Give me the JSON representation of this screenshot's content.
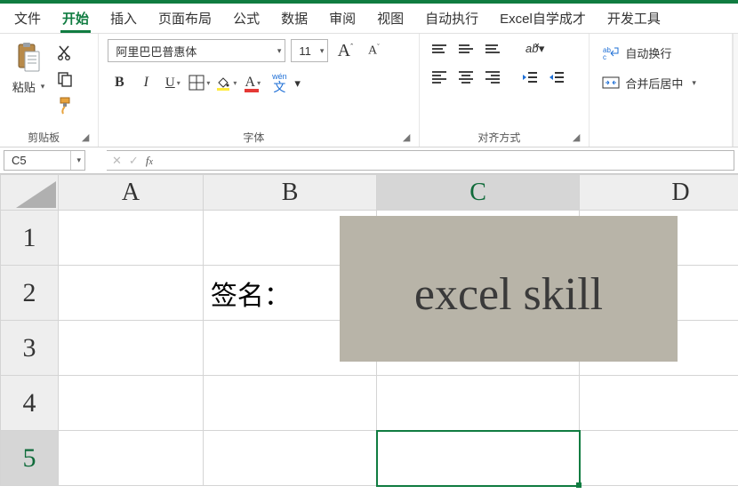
{
  "tabs": {
    "items": [
      {
        "label": "文件"
      },
      {
        "label": "开始"
      },
      {
        "label": "插入"
      },
      {
        "label": "页面布局"
      },
      {
        "label": "公式"
      },
      {
        "label": "数据"
      },
      {
        "label": "审阅"
      },
      {
        "label": "视图"
      },
      {
        "label": "自动执行"
      },
      {
        "label": "Excel自学成才"
      },
      {
        "label": "开发工具"
      }
    ],
    "active_index": 1
  },
  "ribbon": {
    "clipboard": {
      "paste_label": "粘贴",
      "group_label": "剪贴板"
    },
    "font": {
      "name": "阿里巴巴普惠体",
      "size": "11",
      "ruby_label": "wén",
      "ruby_char": "文",
      "group_label": "字体"
    },
    "align": {
      "group_label": "对齐方式"
    },
    "wrap": {
      "wrap_label": "自动换行",
      "merge_label": "合并后居中"
    }
  },
  "formula_bar": {
    "name_box": "C5",
    "formula": ""
  },
  "grid": {
    "columns": [
      "A",
      "B",
      "C",
      "D"
    ],
    "selected_col_index": 2,
    "rows": [
      "1",
      "2",
      "3",
      "4"
    ],
    "selected_cell": {
      "row": 4,
      "col": 2
    },
    "cells": {
      "B2": "签名："
    },
    "signature_text": "excel skill"
  }
}
